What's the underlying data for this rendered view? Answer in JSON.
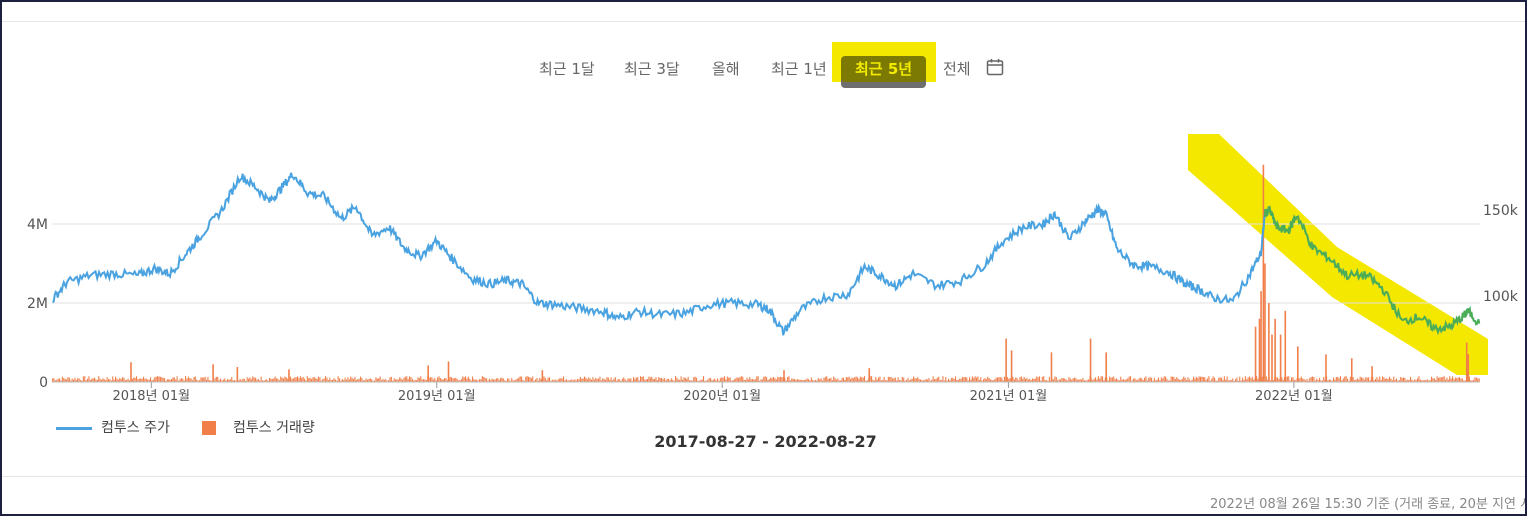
{
  "periods": [
    {
      "label": "최근 1달"
    },
    {
      "label": "최근 3달"
    },
    {
      "label": "올해"
    },
    {
      "label": "최근 1년"
    },
    {
      "label": "최근 5년",
      "active": true
    },
    {
      "label": "전체"
    }
  ],
  "calendar_icon": "calendar-icon",
  "legend": {
    "price_label": "컴투스 주가",
    "volume_label": "컴투스 거래량"
  },
  "date_range": "2017-08-27 - 2022-08-27",
  "footnote": "2022년 08월 26일 15:30 기준 (거래 종료, 20분 지연 시",
  "colors": {
    "price": "#4aa3e0",
    "volume": "#f07f4a",
    "highlight": "#f5e800",
    "highlight_price": "#4caf3c",
    "active_tab_bg": "#7c7a03",
    "active_tab_text": "#f3ec00"
  },
  "chart_data": {
    "type": "line",
    "x_range": [
      "2017-08-27",
      "2022-08-27"
    ],
    "x_ticks": [
      {
        "date": "2018-01-01",
        "label": "2018년 01월"
      },
      {
        "date": "2019-01-01",
        "label": "2019년 01월"
      },
      {
        "date": "2020-01-01",
        "label": "2020년 01월"
      },
      {
        "date": "2021-01-01",
        "label": "2021년 01월"
      },
      {
        "date": "2022-01-01",
        "label": "2022년 01월"
      }
    ],
    "left_axis": {
      "series": "컴투스 거래량",
      "ticks": [
        {
          "value": 0,
          "label": "0"
        },
        {
          "value": 2000000,
          "label": "2M"
        },
        {
          "value": 4000000,
          "label": "4M"
        }
      ],
      "range": [
        0,
        6000000
      ]
    },
    "right_axis": {
      "series": "컴투스 주가",
      "ticks": [
        {
          "value": 100000,
          "label": "100k"
        },
        {
          "value": 150000,
          "label": "150k"
        }
      ],
      "range": [
        50000,
        200000
      ]
    },
    "grid": true,
    "legend_position": "bottom-left",
    "series": [
      {
        "name": "컴투스 주가",
        "type": "line",
        "axis": "right",
        "points": [
          [
            "2017-08-28",
            98000
          ],
          [
            "2017-09-15",
            108000
          ],
          [
            "2017-10-15",
            112000
          ],
          [
            "2017-11-15",
            113000
          ],
          [
            "2017-12-15",
            112000
          ],
          [
            "2018-01-05",
            116000
          ],
          [
            "2018-01-25",
            113000
          ],
          [
            "2018-02-15",
            125000
          ],
          [
            "2018-03-05",
            135000
          ],
          [
            "2018-04-01",
            150000
          ],
          [
            "2018-04-25",
            170000
          ],
          [
            "2018-05-15",
            163000
          ],
          [
            "2018-06-01",
            155000
          ],
          [
            "2018-06-15",
            162000
          ],
          [
            "2018-07-01",
            171000
          ],
          [
            "2018-07-20",
            160000
          ],
          [
            "2018-08-10",
            158000
          ],
          [
            "2018-09-01",
            145000
          ],
          [
            "2018-09-20",
            152000
          ],
          [
            "2018-10-10",
            135000
          ],
          [
            "2018-11-01",
            140000
          ],
          [
            "2018-11-20",
            128000
          ],
          [
            "2018-12-10",
            123000
          ],
          [
            "2019-01-01",
            132000
          ],
          [
            "2019-01-20",
            122000
          ],
          [
            "2019-02-15",
            110000
          ],
          [
            "2019-03-10",
            107000
          ],
          [
            "2019-04-01",
            109000
          ],
          [
            "2019-04-20",
            107000
          ],
          [
            "2019-05-10",
            96000
          ],
          [
            "2019-06-01",
            95000
          ],
          [
            "2019-07-01",
            93000
          ],
          [
            "2019-08-01",
            91000
          ],
          [
            "2019-08-20",
            87000
          ],
          [
            "2019-09-15",
            91000
          ],
          [
            "2019-10-15",
            89000
          ],
          [
            "2019-11-15",
            90000
          ],
          [
            "2019-12-15",
            95000
          ],
          [
            "2020-01-15",
            96000
          ],
          [
            "2020-02-15",
            95000
          ],
          [
            "2020-03-01",
            92000
          ],
          [
            "2020-03-19",
            79000
          ],
          [
            "2020-04-10",
            92000
          ],
          [
            "2020-05-10",
            99000
          ],
          [
            "2020-06-10",
            101000
          ],
          [
            "2020-07-01",
            117000
          ],
          [
            "2020-07-20",
            112000
          ],
          [
            "2020-08-10",
            106000
          ],
          [
            "2020-09-01",
            113000
          ],
          [
            "2020-10-01",
            106000
          ],
          [
            "2020-11-01",
            109000
          ],
          [
            "2020-12-01",
            118000
          ],
          [
            "2020-12-25",
            132000
          ],
          [
            "2021-01-20",
            140000
          ],
          [
            "2021-02-15",
            142000
          ],
          [
            "2021-03-01",
            148000
          ],
          [
            "2021-03-20",
            133000
          ],
          [
            "2021-04-10",
            144000
          ],
          [
            "2021-04-25",
            150000
          ],
          [
            "2021-05-05",
            148000
          ],
          [
            "2021-05-20",
            127000
          ],
          [
            "2021-06-10",
            118000
          ],
          [
            "2021-07-01",
            117000
          ],
          [
            "2021-07-25",
            114000
          ],
          [
            "2021-08-15",
            107000
          ],
          [
            "2021-09-01",
            104000
          ],
          [
            "2021-09-20",
            99000
          ],
          [
            "2021-10-15",
            97000
          ],
          [
            "2021-11-05",
            112000
          ],
          [
            "2021-11-20",
            125000
          ],
          [
            "2021-11-25",
            148000
          ],
          [
            "2021-12-01",
            150000
          ],
          [
            "2021-12-10",
            140000
          ],
          [
            "2021-12-25",
            138000
          ],
          [
            "2022-01-05",
            147000
          ],
          [
            "2022-01-25",
            128000
          ],
          [
            "2022-02-15",
            122000
          ],
          [
            "2022-03-10",
            112000
          ],
          [
            "2022-04-05",
            112000
          ],
          [
            "2022-04-25",
            104000
          ],
          [
            "2022-05-20",
            85000
          ],
          [
            "2022-06-10",
            88000
          ],
          [
            "2022-06-30",
            81000
          ],
          [
            "2022-07-20",
            82000
          ],
          [
            "2022-08-05",
            88000
          ],
          [
            "2022-08-12",
            91000
          ],
          [
            "2022-08-26",
            84000
          ]
        ]
      },
      {
        "name": "컴투스 거래량",
        "type": "bar",
        "axis": "left",
        "baseline": 100000,
        "spikes": [
          [
            "2017-12-05",
            500000
          ],
          [
            "2018-03-20",
            450000
          ],
          [
            "2018-04-20",
            380000
          ],
          [
            "2018-06-25",
            320000
          ],
          [
            "2018-12-20",
            420000
          ],
          [
            "2019-01-15",
            520000
          ],
          [
            "2019-05-15",
            300000
          ],
          [
            "2020-03-19",
            300000
          ],
          [
            "2020-07-06",
            350000
          ],
          [
            "2020-12-28",
            1100000
          ],
          [
            "2021-01-04",
            800000
          ],
          [
            "2021-02-24",
            750000
          ],
          [
            "2021-04-15",
            1100000
          ],
          [
            "2021-05-05",
            750000
          ],
          [
            "2021-11-12",
            1400000
          ],
          [
            "2021-11-17",
            1600000
          ],
          [
            "2021-11-19",
            2300000
          ],
          [
            "2021-11-22",
            5500000
          ],
          [
            "2021-11-24",
            3000000
          ],
          [
            "2021-11-29",
            2000000
          ],
          [
            "2021-12-03",
            1200000
          ],
          [
            "2021-12-07",
            1600000
          ],
          [
            "2021-12-14",
            1200000
          ],
          [
            "2021-12-20",
            1800000
          ],
          [
            "2022-01-05",
            900000
          ],
          [
            "2022-02-10",
            700000
          ],
          [
            "2022-03-15",
            600000
          ],
          [
            "2022-04-10",
            400000
          ],
          [
            "2022-08-09",
            1000000
          ],
          [
            "2022-08-11",
            700000
          ]
        ]
      }
    ]
  }
}
